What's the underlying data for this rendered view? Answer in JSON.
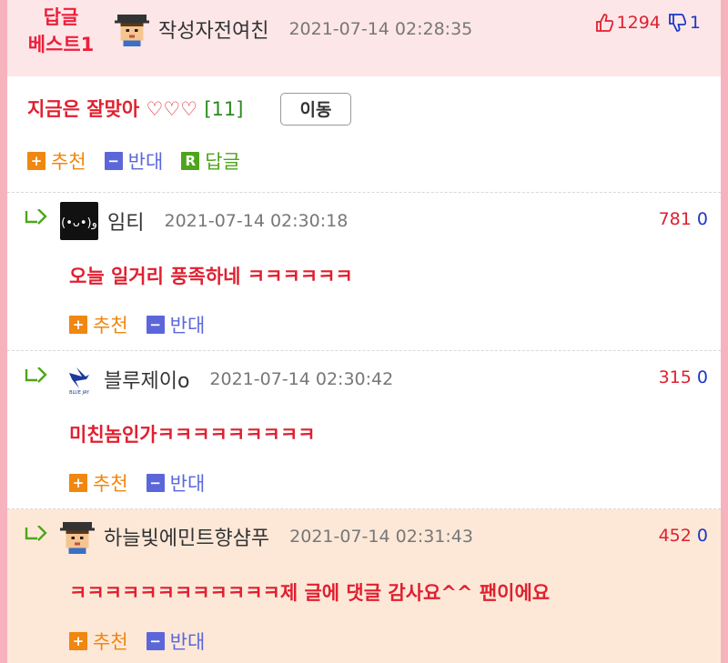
{
  "best": {
    "tag_line1": "답글",
    "tag_line2": "베스트1",
    "author": "작성자전여친",
    "date": "2021-07-14 02:28:35",
    "up": "1294",
    "down": "1",
    "text": "지금은 잘맞아 ",
    "hearts": "♡♡♡",
    "comment_count": "[11]",
    "move_label": "이동",
    "actions": {
      "recommend": "추천",
      "oppose": "반대",
      "reply": "답글",
      "recommend_icon": "+",
      "oppose_icon": "−",
      "reply_icon": "R"
    }
  },
  "replies": [
    {
      "author": "임티",
      "date": "2021-07-14 02:30:18",
      "up": "781",
      "down": "0",
      "text": "오늘 일거리 풍족하네 ㅋㅋㅋㅋㅋㅋ",
      "recommend": "추천",
      "oppose": "반대"
    },
    {
      "author": "블루제이o",
      "date": "2021-07-14 02:30:42",
      "up": "315",
      "down": "0",
      "text": "미친놈인가ㅋㅋㅋㅋㅋㅋㅋㅋㅋ",
      "recommend": "추천",
      "oppose": "반대"
    },
    {
      "author": "하늘빛에민트향샴푸",
      "date": "2021-07-14 02:31:43",
      "up": "452",
      "down": "0",
      "text": "ㅋㅋㅋㅋㅋㅋㅋㅋㅋㅋㅋㅋ제 글에 댓글 감사요^^ 팬이에요",
      "recommend": "추천",
      "oppose": "반대"
    }
  ],
  "colors": {
    "accent_red": "#e02030",
    "recommend_orange": "#ef8711",
    "oppose_blue": "#5b67d9",
    "reply_green": "#4ea51c",
    "best_bg": "#fde6e8",
    "highlight_bg": "#fde8d8"
  }
}
